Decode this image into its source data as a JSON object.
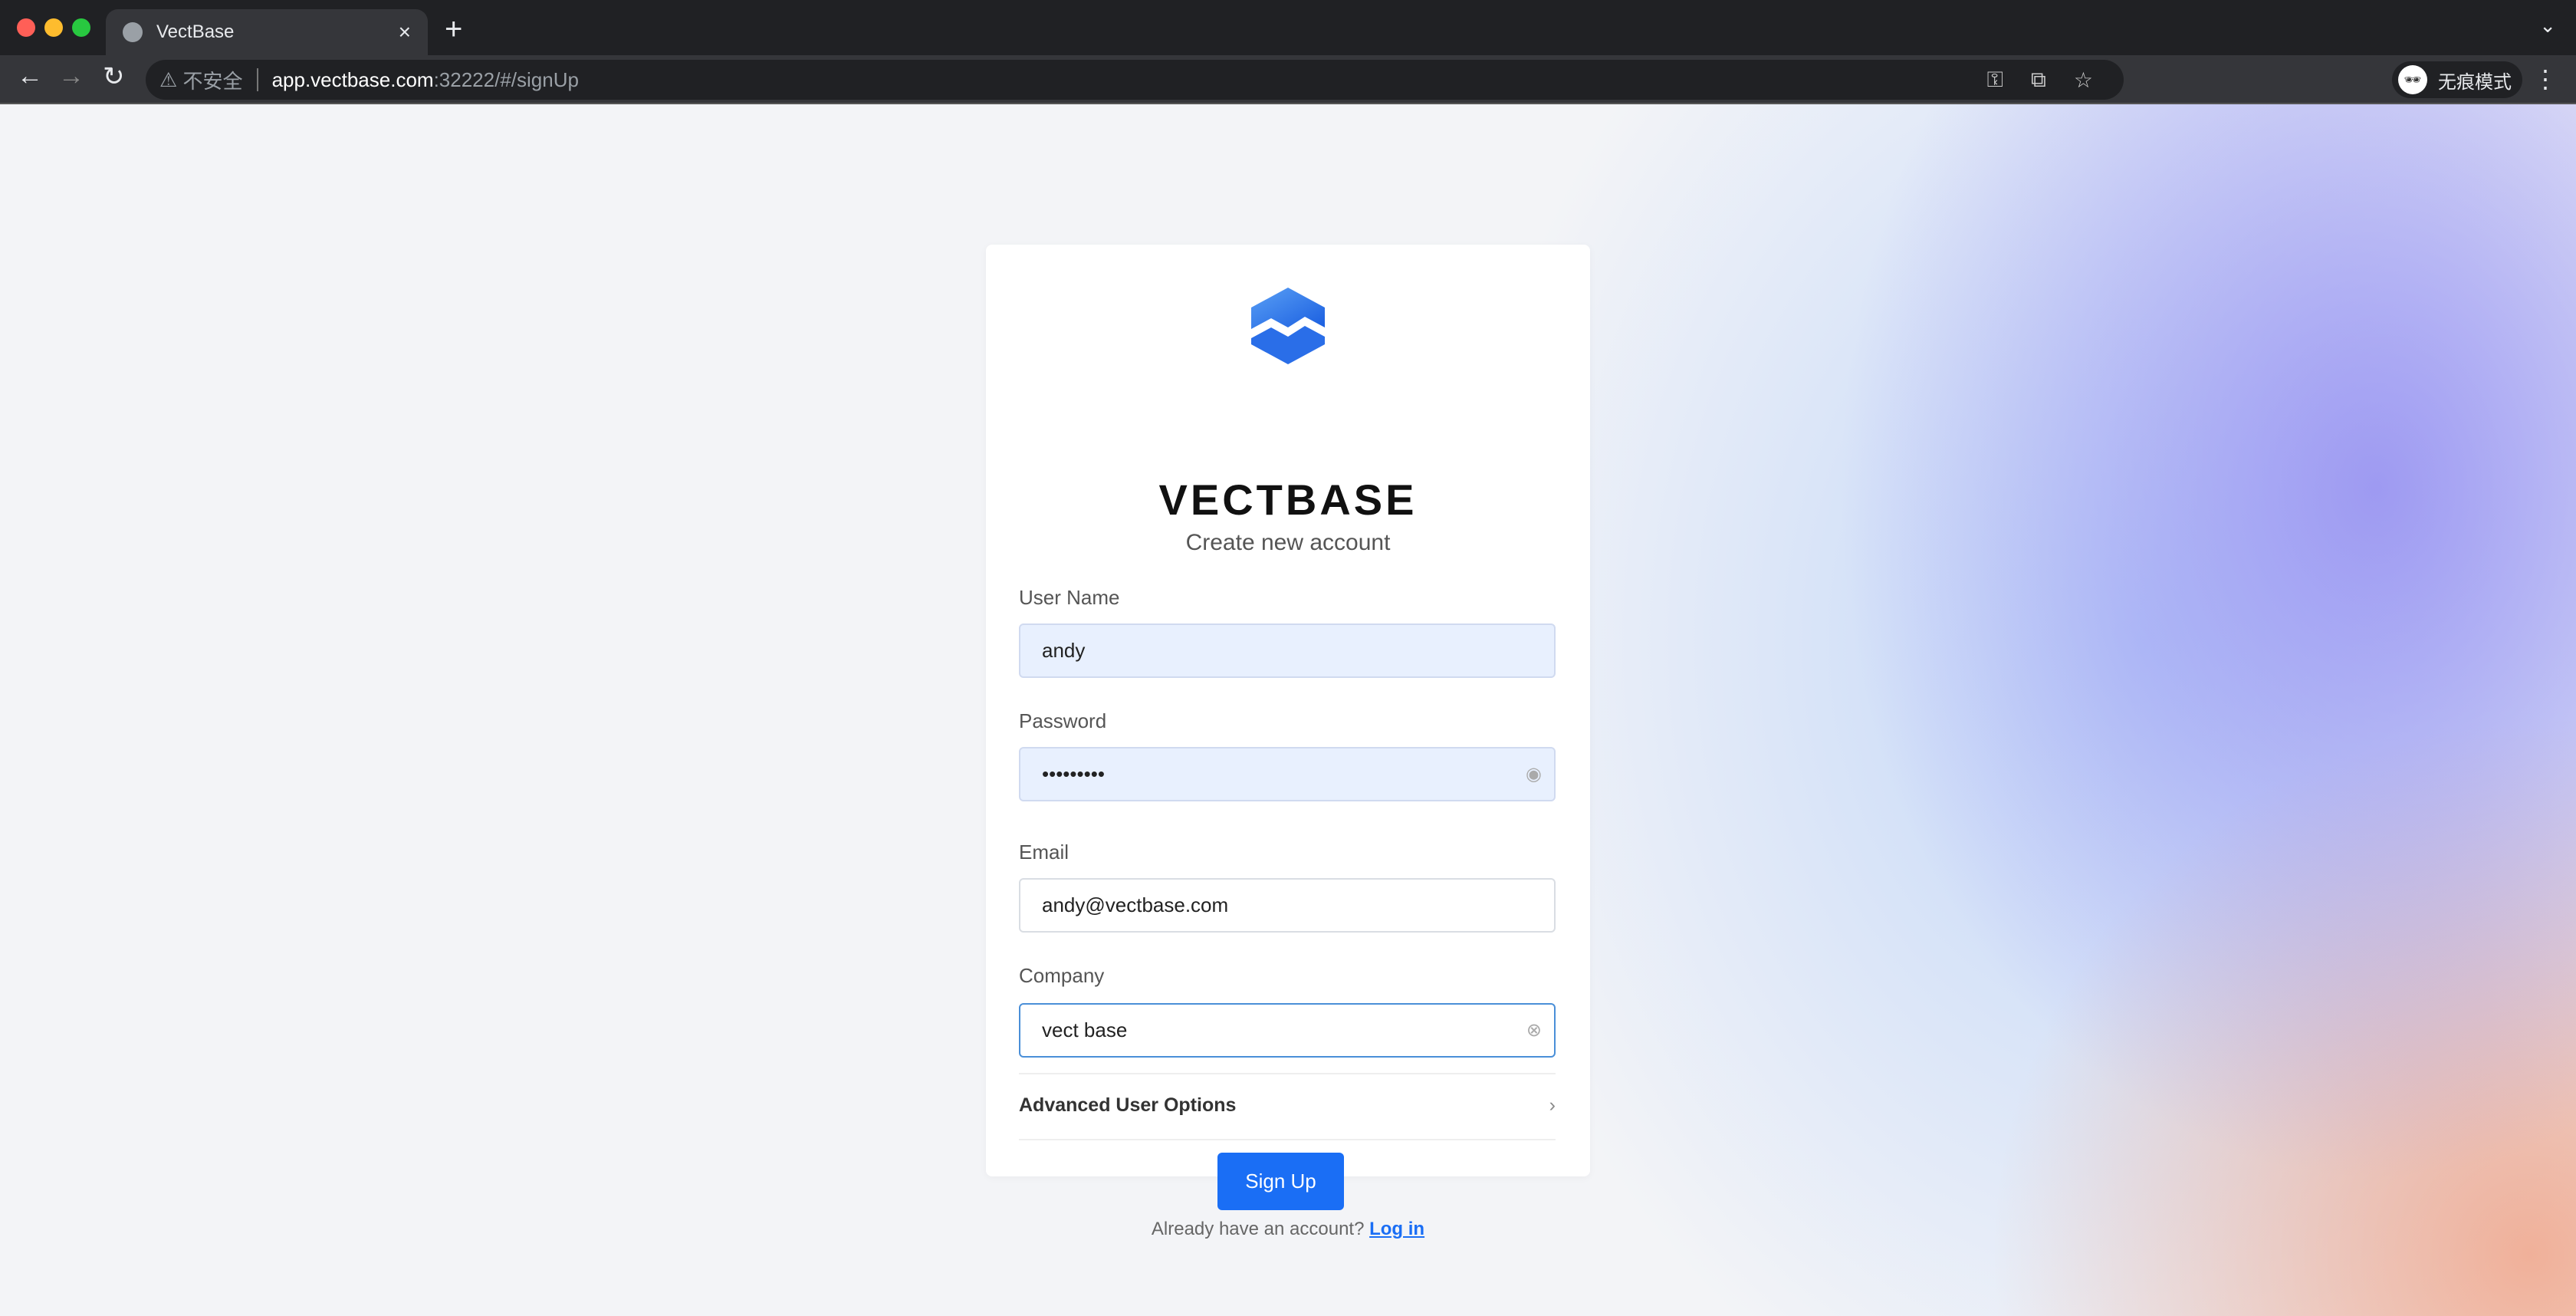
{
  "browser": {
    "tab_title": "VectBase",
    "security_label": "不安全",
    "url_host": "app.vectbase.com",
    "url_rest": ":32222/#/signUp",
    "incognito_label": "无痕模式"
  },
  "brand": {
    "name": "VECTBASE",
    "subtitle": "Create new account"
  },
  "form": {
    "username": {
      "label": "User Name",
      "value": "andy"
    },
    "password": {
      "label": "Password",
      "value": "•••••••••"
    },
    "email": {
      "label": "Email",
      "value": "andy@vectbase.com"
    },
    "company": {
      "label": "Company",
      "value": "vect base"
    },
    "advanced_label": "Advanced User Options",
    "submit_label": "Sign Up",
    "footer_text": "Already have an account?",
    "login_link": "Log in"
  }
}
